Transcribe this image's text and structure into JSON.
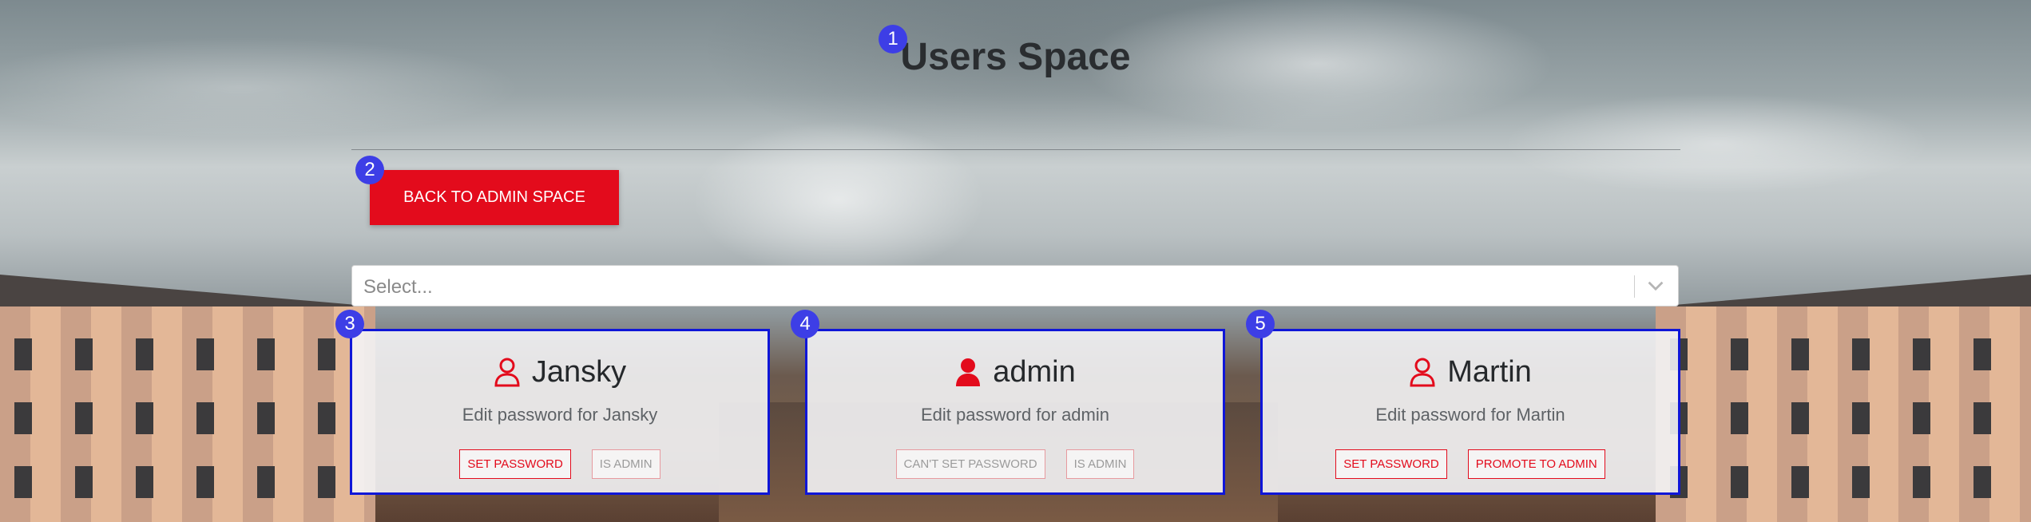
{
  "page": {
    "title": "Users Space"
  },
  "badges": [
    "1",
    "2",
    "3",
    "4",
    "5"
  ],
  "back_button": {
    "label": "BACK TO ADMIN SPACE"
  },
  "select": {
    "placeholder": "Select..."
  },
  "colors": {
    "accent": "#e30b1c",
    "card_border": "#0f16d8",
    "badge": "#3d3ee6"
  },
  "users": [
    {
      "name": "Jansky",
      "icon": "user-outline-icon",
      "subtitle": "Edit password for Jansky",
      "primary": {
        "label": "SET PASSWORD",
        "enabled": true
      },
      "secondary": {
        "label": "IS ADMIN",
        "enabled": false
      }
    },
    {
      "name": "admin",
      "icon": "user-filled-icon",
      "subtitle": "Edit password for admin",
      "primary": {
        "label": "CAN'T SET PASSWORD",
        "enabled": false
      },
      "secondary": {
        "label": "IS ADMIN",
        "enabled": false
      }
    },
    {
      "name": "Martin",
      "icon": "user-outline-icon",
      "subtitle": "Edit password for Martin",
      "primary": {
        "label": "SET PASSWORD",
        "enabled": true
      },
      "secondary": {
        "label": "PROMOTE TO ADMIN",
        "enabled": true
      }
    }
  ]
}
